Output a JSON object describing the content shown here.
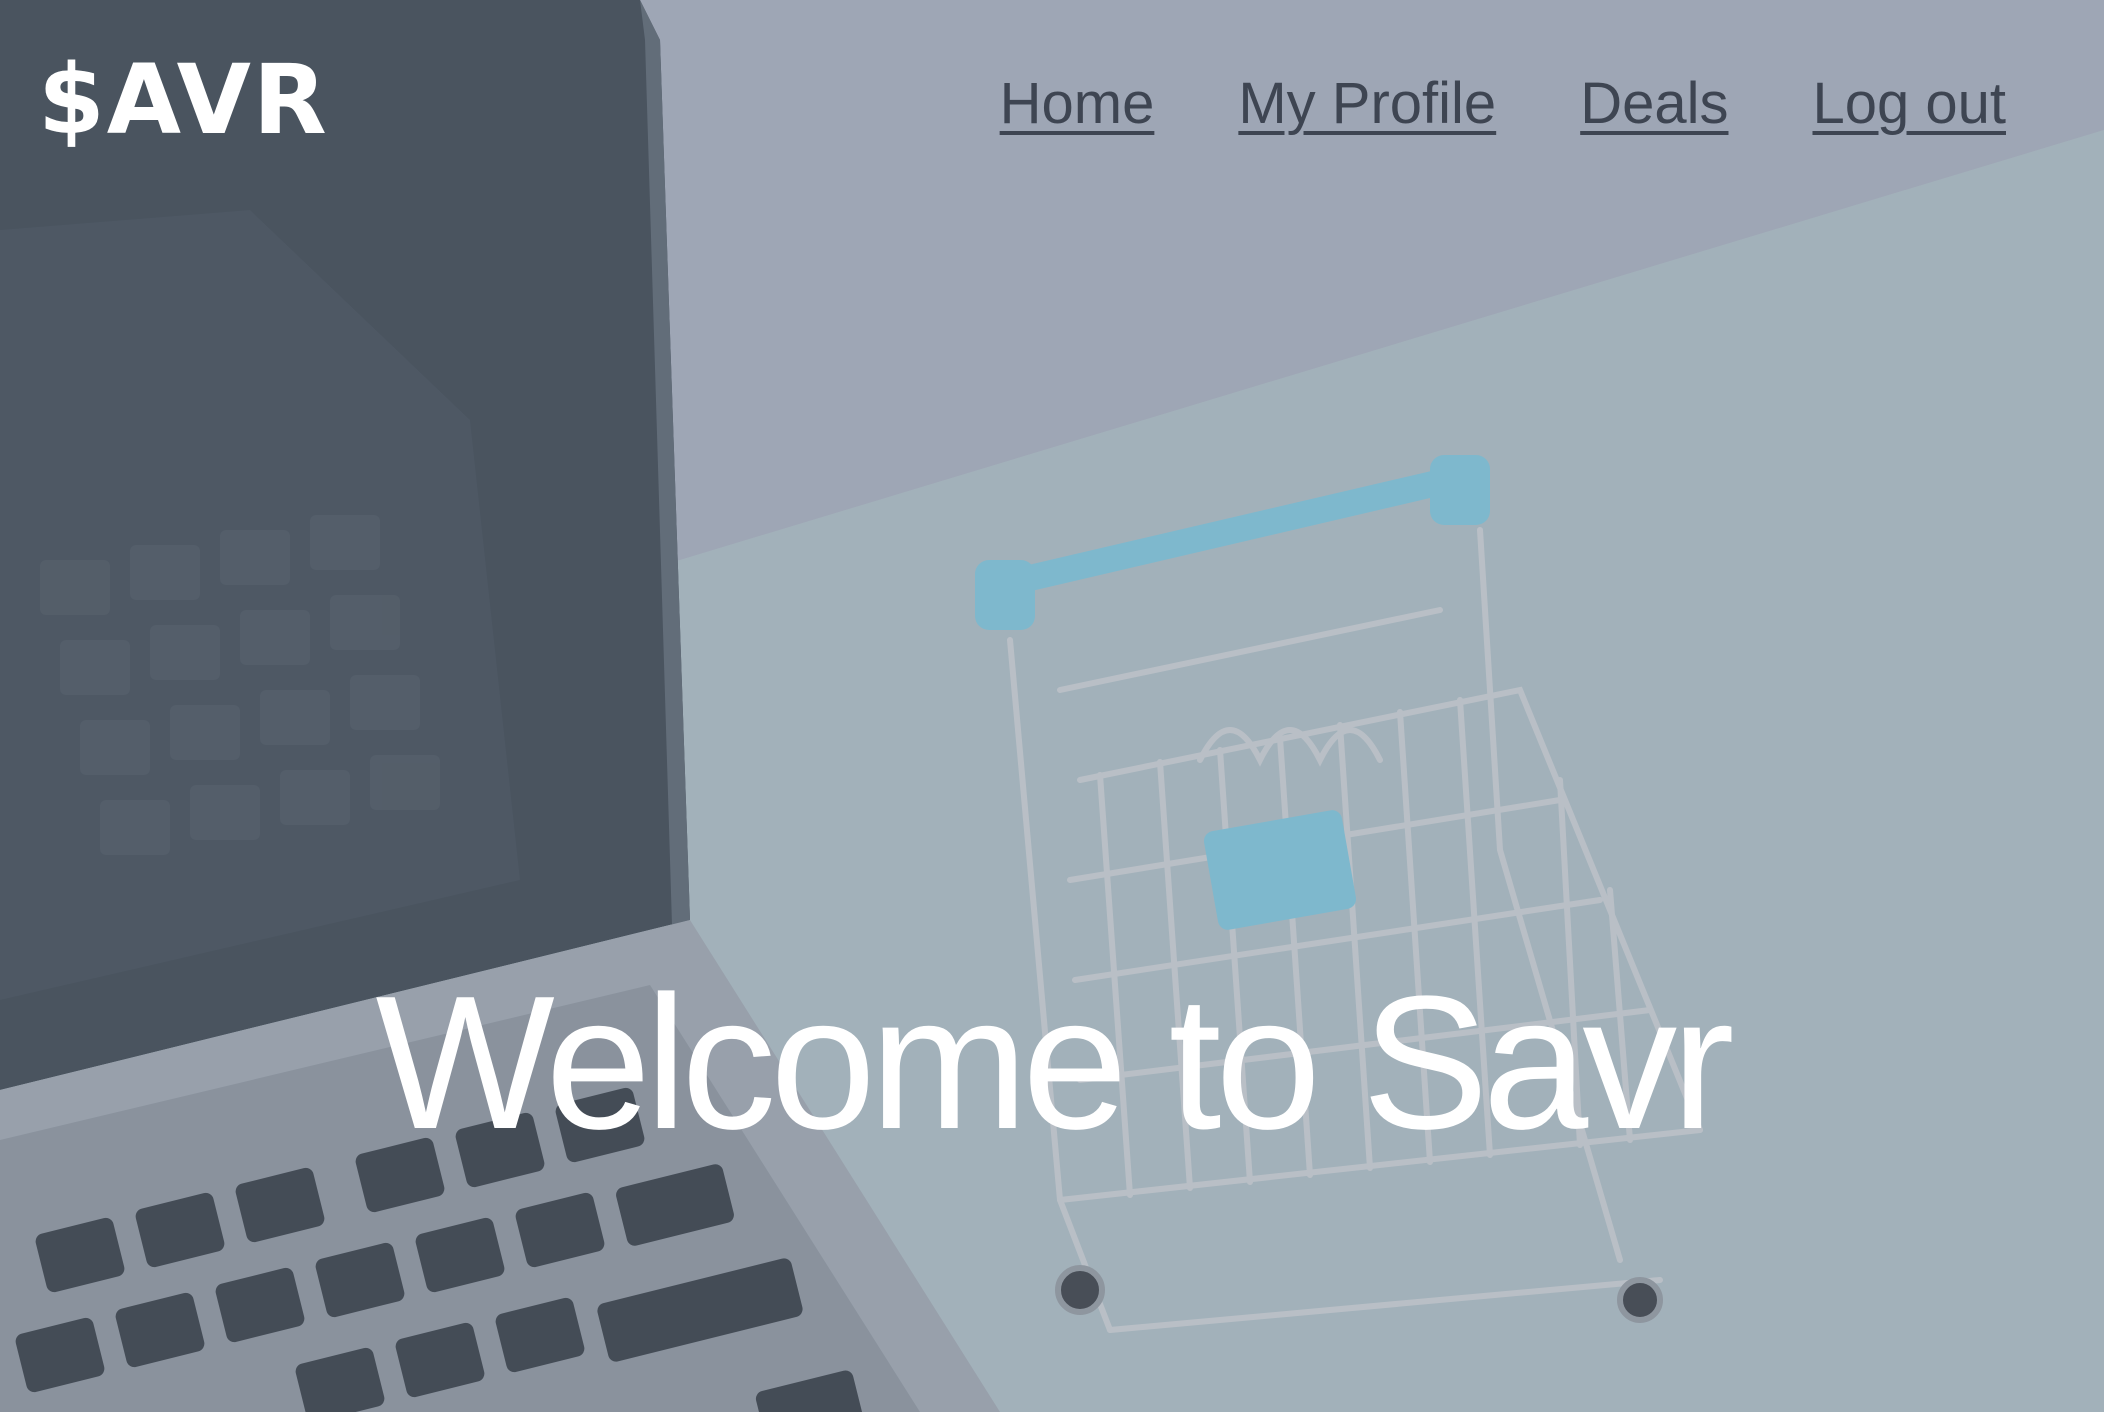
{
  "brand": {
    "logo_text": "$AVR"
  },
  "nav": {
    "items": [
      {
        "label": "Home"
      },
      {
        "label": "My Profile"
      },
      {
        "label": "Deals"
      },
      {
        "label": "Log out"
      }
    ]
  },
  "hero": {
    "headline": "Welcome to Savr",
    "background_image": "laptop-and-shopping-cart-photo"
  },
  "colors": {
    "nav_link": "#3e4552",
    "logo": "#ffffff",
    "headline": "#ffffff",
    "cart_accent": "#7cc0d6"
  }
}
